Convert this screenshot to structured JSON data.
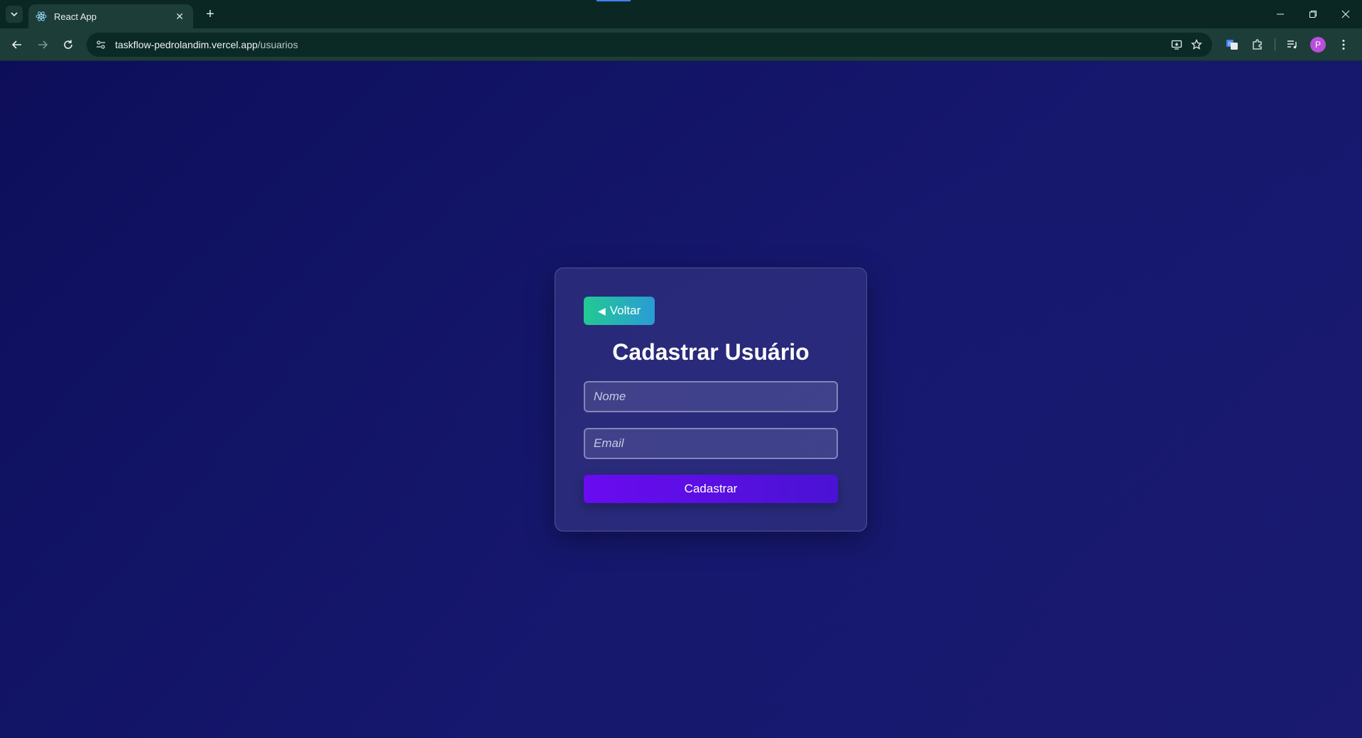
{
  "browser": {
    "tab_title": "React App",
    "url_host": "taskflow-pedrolandim.vercel.app",
    "url_path": "/usuarios",
    "profile_initial": "P"
  },
  "form": {
    "back_label": "Voltar",
    "title": "Cadastrar Usuário",
    "name_placeholder": "Nome",
    "email_placeholder": "Email",
    "submit_label": "Cadastrar"
  },
  "colors": {
    "page_bg": "#12135f",
    "back_button_from": "#22c993",
    "back_button_to": "#2a9bd6",
    "submit_button": "#6a0bf0",
    "avatar": "#b84fd9"
  }
}
